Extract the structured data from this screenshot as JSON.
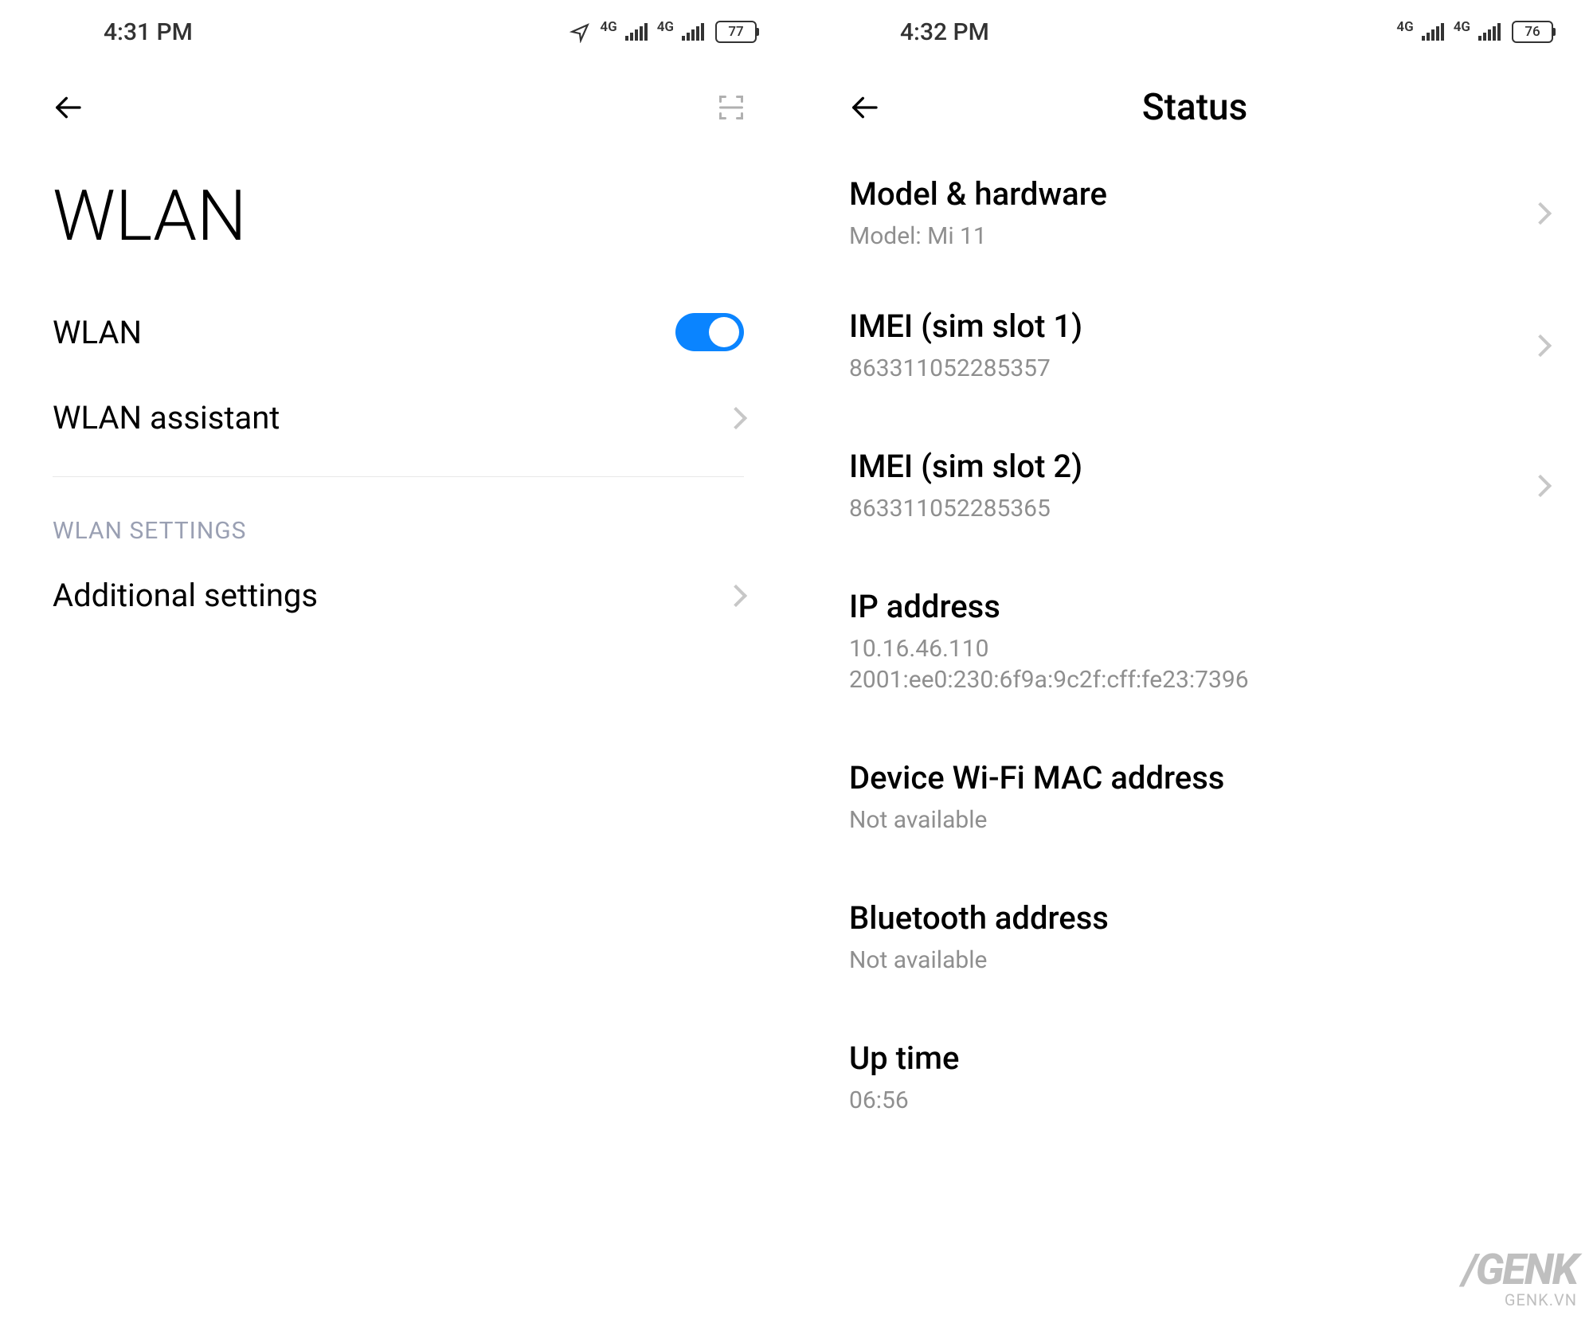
{
  "left": {
    "status_bar": {
      "time": "4:31 PM",
      "network": "4G",
      "battery": "77"
    },
    "page_title": "WLAN",
    "wlan_row": {
      "label": "WLAN",
      "on": true
    },
    "assistant_row": {
      "label": "WLAN assistant"
    },
    "section_header": "WLAN SETTINGS",
    "additional_row": {
      "label": "Additional settings"
    }
  },
  "right": {
    "status_bar": {
      "time": "4:32 PM",
      "network": "4G",
      "battery": "76"
    },
    "nav_title": "Status",
    "items": {
      "model": {
        "title": "Model & hardware",
        "sub": "Model: Mi 11",
        "chevron": true
      },
      "imei1": {
        "title": "IMEI (sim slot 1)",
        "sub": "863311052285357",
        "chevron": true
      },
      "imei2": {
        "title": "IMEI (sim slot 2)",
        "sub": "863311052285365",
        "chevron": true
      },
      "ip": {
        "title": "IP address",
        "sub": "10.16.46.110\n2001:ee0:230:6f9a:9c2f:cff:fe23:7396",
        "chevron": false
      },
      "wifi_mac": {
        "title": "Device Wi-Fi MAC address",
        "sub": "Not available",
        "chevron": false
      },
      "bt": {
        "title": "Bluetooth address",
        "sub": "Not available",
        "chevron": false
      },
      "uptime": {
        "title": "Up time",
        "sub": "06:56",
        "chevron": false
      }
    }
  },
  "watermark": {
    "brand": "/GENK",
    "url": "GENK.VN"
  }
}
